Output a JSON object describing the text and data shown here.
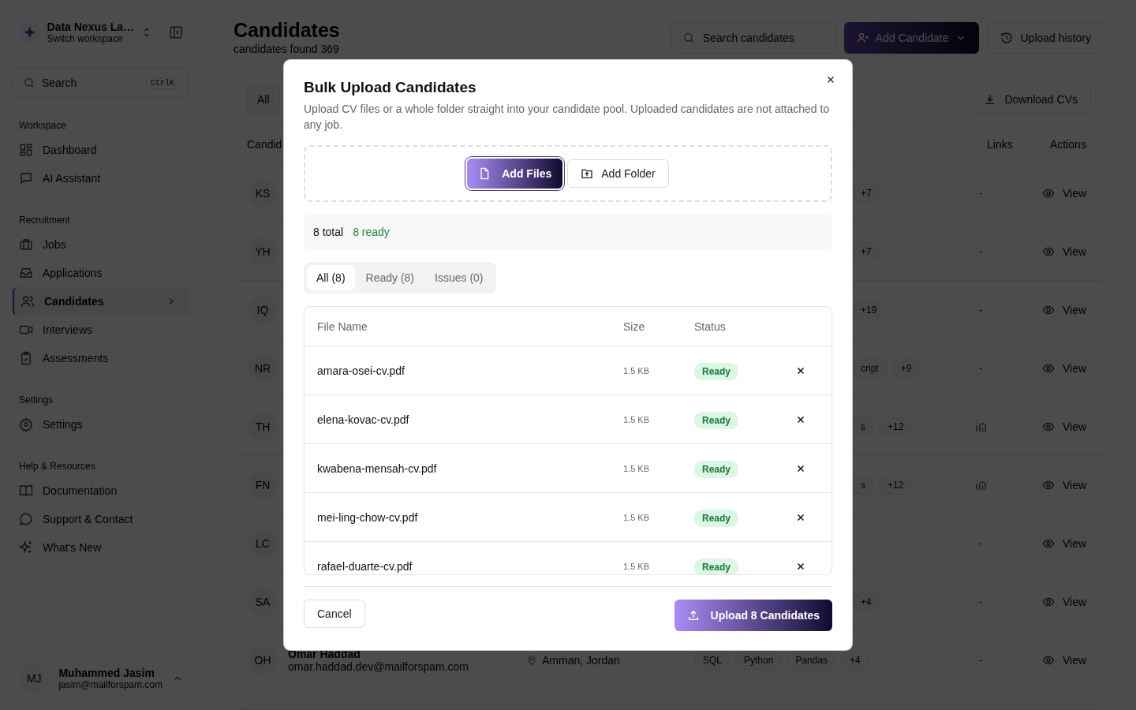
{
  "sidebar": {
    "workspace": {
      "name": "Data Nexus La…",
      "subtitle": "Switch workspace"
    },
    "search": {
      "placeholder": "Search",
      "shortcut": "CtrlK"
    },
    "sections": [
      {
        "title": "Workspace",
        "items": [
          {
            "label": "Dashboard",
            "selected": false
          },
          {
            "label": "AI Assistant",
            "selected": false
          }
        ]
      },
      {
        "title": "Recruitment",
        "items": [
          {
            "label": "Jobs",
            "selected": false
          },
          {
            "label": "Applications",
            "selected": false
          },
          {
            "label": "Candidates",
            "selected": true
          },
          {
            "label": "Interviews",
            "selected": false
          },
          {
            "label": "Assessments",
            "selected": false
          }
        ]
      },
      {
        "title": "Settings",
        "items": [
          {
            "label": "Settings",
            "selected": false
          }
        ]
      },
      {
        "title": "Help & Resources",
        "items": [
          {
            "label": "Documentation",
            "selected": false
          },
          {
            "label": "Support & Contact",
            "selected": false
          },
          {
            "label": "What's New",
            "selected": false
          }
        ]
      }
    ],
    "user": {
      "initials": "MJ",
      "name": "Muhammed Jasim",
      "email": "jasim@mailforspam.com"
    }
  },
  "page": {
    "title": "Candidates",
    "subtitle": "candidates found 369",
    "search_placeholder": "Search candidates",
    "add_button": "Add Candidate",
    "history_button": "Upload history"
  },
  "filters": {
    "tab": "All",
    "download_button": "Download CVs"
  },
  "table": {
    "columns": [
      "Candid",
      "Links",
      "Actions"
    ],
    "rows": [
      {
        "initials": "KS",
        "skills": [
          "+7"
        ],
        "link": {
          "kind": "none",
          "text": "-"
        },
        "action": "View"
      },
      {
        "initials": "YH",
        "skills": [
          "+7"
        ],
        "link": {
          "kind": "none",
          "text": "-"
        },
        "action": "View"
      },
      {
        "initials": "IQ",
        "skills": [
          "+19"
        ],
        "link": {
          "kind": "none",
          "text": "-"
        },
        "action": "View"
      },
      {
        "initials": "NR",
        "skills": [
          "cript",
          "+9"
        ],
        "link": {
          "kind": "none",
          "text": "-"
        },
        "action": "View"
      },
      {
        "initials": "TH",
        "skills": [
          "s",
          "+12"
        ],
        "link": {
          "kind": "linkedin"
        },
        "action": "View"
      },
      {
        "initials": "FN",
        "skills": [
          "s",
          "+12"
        ],
        "link": {
          "kind": "linkedin"
        },
        "action": "View"
      },
      {
        "initials": "LC",
        "skills": [],
        "link": {
          "kind": "none",
          "text": "-"
        },
        "action": "View"
      },
      {
        "initials": "SA",
        "skills": [
          "+4"
        ],
        "link": {
          "kind": "none",
          "text": "-"
        },
        "action": "View"
      },
      {
        "initials": "OH",
        "name": "Omar Haddad",
        "email": "omar.haddad.dev@mailforspam.com",
        "location": "Amman, Jordan",
        "skills": [
          "SQL",
          "Python",
          "Pandas",
          "+4"
        ],
        "link": {
          "kind": "none",
          "text": "-"
        },
        "action": "View"
      }
    ]
  },
  "modal": {
    "title": "Bulk Upload Candidates",
    "description": "Upload CV files or a whole folder straight into your candidate pool. Uploaded candidates are not attached to any job.",
    "add_files": "Add Files",
    "add_folder": "Add Folder",
    "total": "8 total",
    "ready": "8 ready",
    "tabs": [
      {
        "label": "All (8)",
        "selected": true
      },
      {
        "label": "Ready (8)",
        "selected": false
      },
      {
        "label": "Issues (0)",
        "selected": false
      }
    ],
    "columns": [
      "File Name",
      "Size",
      "Status"
    ],
    "files": [
      {
        "name": "amara-osei-cv.pdf",
        "size": "1.5 KB",
        "status": "Ready"
      },
      {
        "name": "elena-kovac-cv.pdf",
        "size": "1.5 KB",
        "status": "Ready"
      },
      {
        "name": "kwabena-mensah-cv.pdf",
        "size": "1.5 KB",
        "status": "Ready"
      },
      {
        "name": "mei-ling-chow-cv.pdf",
        "size": "1.5 KB",
        "status": "Ready"
      },
      {
        "name": "rafael-duarte-cv.pdf",
        "size": "1.5 KB",
        "status": "Ready"
      }
    ],
    "cancel": "Cancel",
    "upload": "Upload 8 Candidates"
  }
}
